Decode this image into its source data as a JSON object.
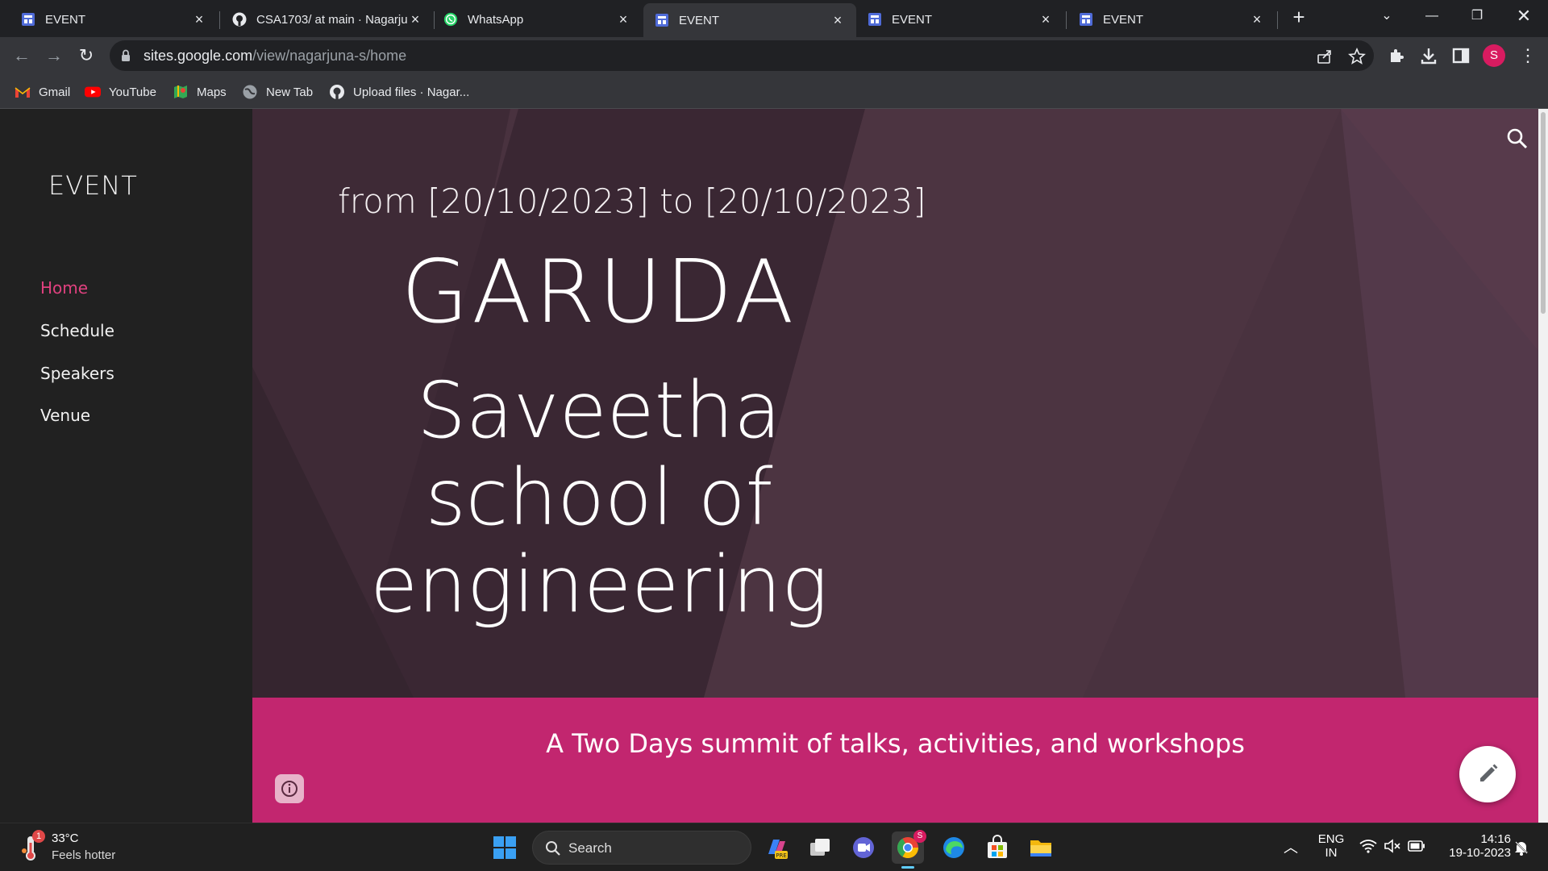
{
  "browser": {
    "tabs": [
      {
        "title": "EVENT",
        "favicon": "google-sites-icon",
        "active": false
      },
      {
        "title": "CSA1703/ at main · Nagarjun",
        "favicon": "github-icon",
        "active": false
      },
      {
        "title": "WhatsApp",
        "favicon": "whatsapp-icon",
        "active": false
      },
      {
        "title": "EVENT",
        "favicon": "google-sites-icon",
        "active": true
      },
      {
        "title": "EVENT",
        "favicon": "google-sites-icon",
        "active": false
      },
      {
        "title": "EVENT",
        "favicon": "google-sites-icon",
        "active": false
      }
    ],
    "url_host": "sites.google.com",
    "url_path": "/view/nagarjuna-s/home",
    "profile_initial": "S",
    "bookmarks": [
      {
        "label": "Gmail",
        "icon": "gmail-icon"
      },
      {
        "label": "YouTube",
        "icon": "youtube-icon"
      },
      {
        "label": "Maps",
        "icon": "maps-icon"
      },
      {
        "label": "New Tab",
        "icon": "globe-icon"
      },
      {
        "label": "Upload files · Nagar...",
        "icon": "github-icon"
      }
    ]
  },
  "site": {
    "title": "EVENT",
    "nav": [
      {
        "label": "Home",
        "active": true
      },
      {
        "label": "Schedule",
        "active": false
      },
      {
        "label": "Speakers",
        "active": false
      },
      {
        "label": "Venue",
        "active": false
      }
    ],
    "hero": {
      "date_line": "from [20/10/2023] to [20/10/2023]",
      "title": "GARUDA",
      "subtitle_lines": [
        "Saveetha",
        "school of",
        "engineering"
      ]
    },
    "band_text": "A Two Days summit of talks, activities, and workshops",
    "colors": {
      "accent": "#c2266f",
      "hero_bg": "#4a3340",
      "sidebar_bg": "#212121",
      "nav_active": "#e0417f"
    }
  },
  "taskbar": {
    "weather_temp": "33°C",
    "weather_desc": "Feels hotter",
    "weather_badge": "1",
    "search_label": "Search",
    "language_top": "ENG",
    "language_bottom": "IN",
    "time": "14:16",
    "date": "19-10-2023",
    "chrome_badge": "S"
  }
}
